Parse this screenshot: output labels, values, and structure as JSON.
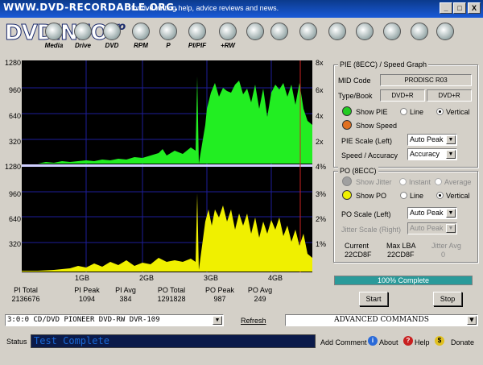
{
  "titlebar": {
    "site": "WWW.DVD-RECORDABLE.ORG.",
    "tagline": "for dvd writing help, advice reviews and news.",
    "min": "_",
    "max": "□",
    "close": "X"
  },
  "brand": {
    "name": "DVDINFO",
    "pro": "pro"
  },
  "toolbar": [
    {
      "id": "media",
      "label": "Media"
    },
    {
      "id": "drive",
      "label": "Drive"
    },
    {
      "id": "dvd",
      "label": "DVD"
    },
    {
      "id": "rpm",
      "label": "RPM"
    },
    {
      "id": "p",
      "label": "P"
    },
    {
      "id": "pipif",
      "label": "PI/PIF"
    },
    {
      "id": "rw",
      "label": "+RW"
    }
  ],
  "graph": {
    "top_y_ticks": [
      "1280",
      "960",
      "640",
      "320"
    ],
    "top_r_ticks": [
      "8x",
      "6x",
      "4x",
      "2x"
    ],
    "mid_left": "1280",
    "mid_right": "4%",
    "bottom_y_ticks": [
      "960",
      "640",
      "320"
    ],
    "bottom_r_ticks": [
      "3%",
      "2%",
      "1%"
    ],
    "x_ticks": [
      "1GB",
      "2GB",
      "3GB",
      "4GB"
    ]
  },
  "stats": [
    {
      "label": "PI Total",
      "value": "2136676"
    },
    {
      "label": "PI Peak",
      "value": "1094"
    },
    {
      "label": "PI Avg",
      "value": "384"
    },
    {
      "label": "PO Total",
      "value": "1291828"
    },
    {
      "label": "PO Peak",
      "value": "987"
    },
    {
      "label": "PO Avg",
      "value": "249"
    }
  ],
  "pie_panel": {
    "title": "PIE (8ECC) / Speed Graph",
    "mid_code_label": "MID Code",
    "mid_code_value": "PRODISC R03",
    "type_book_label": "Type/Book",
    "type_value": "DVD+R",
    "book_value": "DVD+R",
    "show_pie": "Show PIE",
    "show_speed": "Show Speed",
    "line": "Line",
    "vertical": "Vertical",
    "pie_scale_label": "PIE Scale (Left)",
    "pie_scale_value": "Auto Peak",
    "speed_acc_label": "Speed / Accuracy",
    "speed_acc_value": "Accuracy",
    "pie_color": "#22cc22",
    "speed_color": "#e07020"
  },
  "po_panel": {
    "title": "PO (8ECC)",
    "show_jitter": "Show Jitter",
    "instant": "Instant",
    "average": "Average",
    "show_po": "Show PO",
    "line": "Line",
    "vertical": "Vertical",
    "po_scale_label": "PO Scale (Left)",
    "po_scale_value": "Auto Peak",
    "jitter_scale_label": "Jitter Scale (Right)",
    "jitter_scale_value": "Auto Peak",
    "po_color": "#f0f000"
  },
  "position": {
    "current_label": "Current",
    "current_value": "22CD8F",
    "max_lba_label": "Max LBA",
    "max_lba_value": "22CD8F",
    "jitter_avg_label": "Jitter Avg",
    "jitter_avg_value": "0"
  },
  "progress": {
    "text": "100% Complete",
    "fraction": 1.0
  },
  "buttons": {
    "start": "Start",
    "stop": "Stop"
  },
  "drive_select": "3:0:0  CD/DVD PIONEER DVD-RW  DVR-109",
  "refresh": "Refresh",
  "advanced": "ADVANCED COMMANDS",
  "status": {
    "label": "Status",
    "text": "Test Complete"
  },
  "footer": {
    "add_comment": "Add Comment",
    "about": "About",
    "help": "Help",
    "donate": "Donate"
  }
}
